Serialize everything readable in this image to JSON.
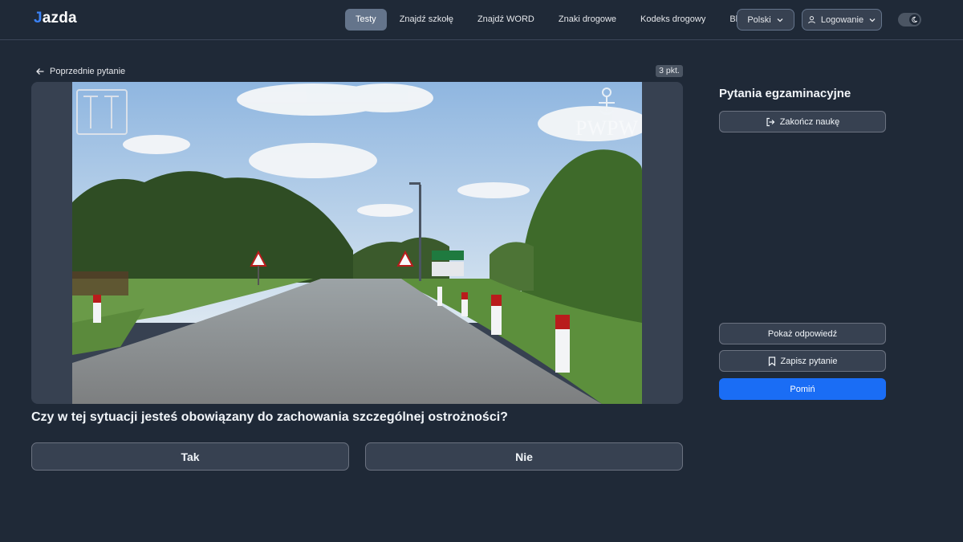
{
  "header": {
    "logo": {
      "accent": "J",
      "text": "azda"
    },
    "nav": [
      "Testy",
      "Znajdź szkołę",
      "Znajdź WORD",
      "Znaki drogowe",
      "Kodeks drogowy",
      "Blog"
    ],
    "language": "Polski",
    "login": "Logowanie",
    "theme_icon": "moon-icon"
  },
  "question": {
    "back_label": "Poprzednie pytanie",
    "points": "3 pkt.",
    "media": {
      "watermark_left": "ITS",
      "watermark_right": "PWPW"
    },
    "text": "Czy w tej sytuacji jesteś obowiązany do zachowania szczególnej ostrożności?",
    "answers": [
      "Tak",
      "Nie"
    ]
  },
  "sidebar": {
    "title": "Pytania egzaminacyjne",
    "finish_label": "Zakończ naukę",
    "show_answer_label": "Pokaż odpowiedź",
    "save_label": "Zapisz pytanie",
    "skip_label": "Pomiń"
  },
  "colors": {
    "background": "#1f2937",
    "panel": "#374151",
    "accent": "#1a6df5",
    "logo_accent": "#3b82f6"
  }
}
